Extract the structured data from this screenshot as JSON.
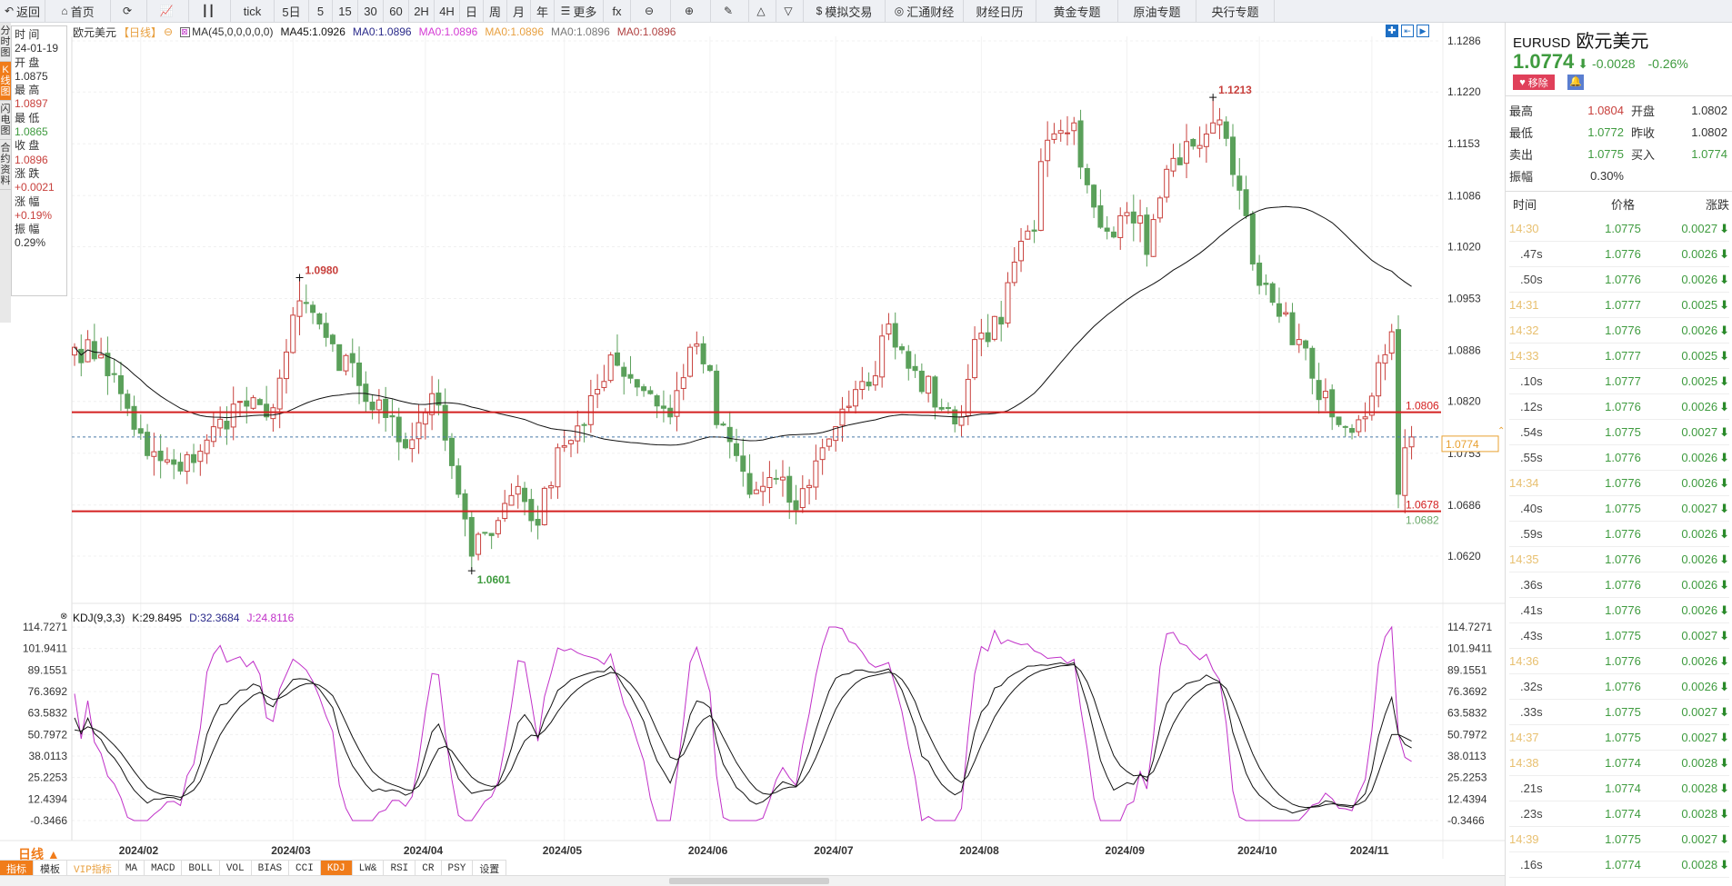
{
  "toolbar": {
    "items": [
      {
        "icon": "↶",
        "label": "返回",
        "name": "back-button"
      },
      {
        "icon": "⌂",
        "label": "首页",
        "name": "home-button"
      },
      {
        "icon": "⟳",
        "label": "",
        "name": "refresh-button"
      },
      {
        "icon": "📈",
        "label": "",
        "name": "line-chart-button"
      },
      {
        "icon": "┃┃",
        "label": "",
        "name": "candle-chart-button"
      },
      {
        "icon": "",
        "label": "tick",
        "name": "tick-button"
      },
      {
        "icon": "",
        "label": "5日",
        "name": "period-5d"
      },
      {
        "icon": "",
        "label": "5",
        "name": "period-5"
      },
      {
        "icon": "",
        "label": "15",
        "name": "period-15"
      },
      {
        "icon": "",
        "label": "30",
        "name": "period-30"
      },
      {
        "icon": "",
        "label": "60",
        "name": "period-60"
      },
      {
        "icon": "",
        "label": "2H",
        "name": "period-2h"
      },
      {
        "icon": "",
        "label": "4H",
        "name": "period-4h"
      },
      {
        "icon": "",
        "label": "日",
        "name": "period-day"
      },
      {
        "icon": "",
        "label": "周",
        "name": "period-week"
      },
      {
        "icon": "",
        "label": "月",
        "name": "period-month"
      },
      {
        "icon": "",
        "label": "年",
        "name": "period-year"
      },
      {
        "icon": "☰",
        "label": "更多",
        "name": "more-button"
      },
      {
        "icon": "",
        "label": "fx",
        "name": "formula-button"
      },
      {
        "icon": "⊖",
        "label": "",
        "name": "zoom-out-button"
      },
      {
        "icon": "⊕",
        "label": "",
        "name": "zoom-in-button"
      },
      {
        "icon": "✎",
        "label": "",
        "name": "draw-button"
      },
      {
        "icon": "△",
        "label": "",
        "name": "up-triangle-button"
      },
      {
        "icon": "▽",
        "label": "",
        "name": "down-triangle-button"
      },
      {
        "icon": "$",
        "label": "模拟交易",
        "name": "sim-trade-button"
      },
      {
        "icon": "◎",
        "label": "汇通财经",
        "name": "huitong-button"
      },
      {
        "icon": "",
        "label": "财经日历",
        "name": "calendar-button"
      },
      {
        "icon": "",
        "label": "黄金专题",
        "name": "gold-button"
      },
      {
        "icon": "",
        "label": "原油专题",
        "name": "oil-button"
      },
      {
        "icon": "",
        "label": "央行专题",
        "name": "central-bank-button"
      }
    ]
  },
  "side_tabs": [
    "分时图",
    "K线图",
    "闪电图",
    "合约资料"
  ],
  "info_panel": [
    {
      "label": "时 间",
      "value": "24-01-19",
      "color": "#333"
    },
    {
      "label": "开 盘",
      "value": "1.0875",
      "color": "#333"
    },
    {
      "label": "最 高",
      "value": "1.0897",
      "color": "#c8403c"
    },
    {
      "label": "最 低",
      "value": "1.0865",
      "color": "#3f9b3f"
    },
    {
      "label": "收 盘",
      "value": "1.0896",
      "color": "#c8403c"
    },
    {
      "label": "涨 跌",
      "value": "+0.0021",
      "color": "#c8403c"
    },
    {
      "label": "涨 幅",
      "value": "+0.19%",
      "color": "#c8403c"
    },
    {
      "label": "振 幅",
      "value": "0.29%",
      "color": "#333"
    }
  ],
  "title": {
    "name": "欧元美元",
    "period": "【日线】",
    "ma_params": "MA(45,0,0,0,0,0)",
    "ma_values": [
      {
        "text": "MA45:1.0926",
        "color": "#111"
      },
      {
        "text": "MA0:1.0896",
        "color": "#2a2a8a"
      },
      {
        "text": "MA0:1.0896",
        "color": "#d43ad4"
      },
      {
        "text": "MA0:1.0896",
        "color": "#e8a040"
      },
      {
        "text": "MA0:1.0896",
        "color": "#777"
      },
      {
        "text": "MA0:1.0896",
        "color": "#b04040"
      }
    ]
  },
  "kdj": {
    "label": "KDJ(9,3,3)",
    "k": "K:29.8495",
    "d": "D:32.3684",
    "j": "J:24.8116"
  },
  "chart_data": {
    "type": "candlestick",
    "symbol": "EURUSD",
    "period": "日线",
    "price_ticks": [
      "1.1286",
      "1.1220",
      "1.1153",
      "1.1086",
      "1.1020",
      "1.0953",
      "1.0886",
      "1.0820",
      "1.0753",
      "1.0686",
      "1.0620"
    ],
    "price_range": [
      1.062,
      1.1286
    ],
    "kdj_ticks": [
      "114.7271",
      "101.9411",
      "89.1551",
      "76.3692",
      "63.5832",
      "50.7972",
      "38.0113",
      "25.2253",
      "12.4394",
      "-0.3466"
    ],
    "kdj_range": [
      -0.3466,
      114.7271
    ],
    "date_ticks": [
      {
        "label": "2024/02",
        "idx": 10
      },
      {
        "label": "2024/03",
        "idx": 33
      },
      {
        "label": "2024/04",
        "idx": 53
      },
      {
        "label": "2024/05",
        "idx": 74
      },
      {
        "label": "2024/06",
        "idx": 96
      },
      {
        "label": "2024/07",
        "idx": 115
      },
      {
        "label": "2024/08",
        "idx": 137
      },
      {
        "label": "2024/09",
        "idx": 159
      },
      {
        "label": "2024/10",
        "idx": 179
      },
      {
        "label": "2024/11",
        "idx": 196
      }
    ],
    "candle_count": 203,
    "close_waypoints": [
      [
        0,
        1.089
      ],
      [
        4,
        1.088
      ],
      [
        7,
        1.083
      ],
      [
        11,
        1.075
      ],
      [
        16,
        1.073
      ],
      [
        20,
        1.077
      ],
      [
        25,
        1.082
      ],
      [
        29,
        1.08
      ],
      [
        31,
        1.085
      ],
      [
        34,
        1.095
      ],
      [
        37,
        1.092
      ],
      [
        40,
        1.086
      ],
      [
        42,
        1.087
      ],
      [
        44,
        1.082
      ],
      [
        48,
        1.08
      ],
      [
        50,
        1.076
      ],
      [
        54,
        1.083
      ],
      [
        56,
        1.077
      ],
      [
        58,
        1.07
      ],
      [
        60,
        1.062
      ],
      [
        62,
        1.065
      ],
      [
        67,
        1.071
      ],
      [
        70,
        1.066
      ],
      [
        73,
        1.076
      ],
      [
        77,
        1.079
      ],
      [
        81,
        1.088
      ],
      [
        84,
        1.085
      ],
      [
        87,
        1.083
      ],
      [
        90,
        1.08
      ],
      [
        93,
        1.089
      ],
      [
        96,
        1.086
      ],
      [
        97,
        1.079
      ],
      [
        100,
        1.075
      ],
      [
        102,
        1.07
      ],
      [
        106,
        1.072
      ],
      [
        109,
        1.068
      ],
      [
        113,
        1.076
      ],
      [
        116,
        1.081
      ],
      [
        120,
        1.084
      ],
      [
        123,
        1.092
      ],
      [
        127,
        1.086
      ],
      [
        131,
        1.081
      ],
      [
        134,
        1.08
      ],
      [
        136,
        1.09
      ],
      [
        140,
        1.092
      ],
      [
        142,
        1.1
      ],
      [
        145,
        1.104
      ],
      [
        146,
        1.113
      ],
      [
        149,
        1.117
      ],
      [
        151,
        1.118
      ],
      [
        153,
        1.11
      ],
      [
        156,
        1.104
      ],
      [
        158,
        1.106
      ],
      [
        161,
        1.106
      ],
      [
        162,
        1.101
      ],
      [
        165,
        1.112
      ],
      [
        169,
        1.115
      ],
      [
        172,
        1.118
      ],
      [
        174,
        1.116
      ],
      [
        177,
        1.106
      ],
      [
        179,
        1.097
      ],
      [
        182,
        1.093
      ],
      [
        185,
        1.09
      ],
      [
        187,
        1.085
      ],
      [
        190,
        1.08
      ],
      [
        191,
        1.079
      ],
      [
        193,
        1.078
      ],
      [
        195,
        1.08
      ],
      [
        197,
        1.087
      ],
      [
        199,
        1.091
      ],
      [
        200,
        1.07
      ],
      [
        201,
        1.076
      ],
      [
        202,
        1.0774
      ]
    ],
    "annotations": [
      {
        "text": "1.0980",
        "idx": 34,
        "price": 1.098,
        "color": "#c8403c"
      },
      {
        "text": "1.0601",
        "idx": 60,
        "price": 1.0601,
        "color": "#3f9b3f"
      },
      {
        "text": "1.1213",
        "idx": 172,
        "price": 1.1213,
        "color": "#c8403c"
      }
    ],
    "hlines": [
      {
        "price": 1.0806,
        "text": "1.0806",
        "color": "#d42020"
      },
      {
        "price": 1.0678,
        "text": "1.0678",
        "color": "#d42020"
      }
    ],
    "low_label": {
      "text": "1.0682",
      "color": "#6aa86a"
    },
    "current_price": {
      "price": 1.0774,
      "text": "1.0774",
      "color": "#e8a030"
    },
    "ma_period": 45,
    "up_color": "#c8403c",
    "down_color": "#5aa05a",
    "k_color": "#111",
    "d_color": "#111",
    "j_color": "#c030c8"
  },
  "bottom": {
    "period_label": "日线 ▲",
    "tabs": [
      "指标",
      "模板",
      "VIP指标",
      "MA",
      "MACD",
      "BOLL",
      "VOL",
      "BIAS",
      "CCI",
      "KDJ",
      "LW&",
      "RSI",
      "CR",
      "PSY",
      "设置"
    ]
  },
  "quote": {
    "code": "EURUSD",
    "name": "欧元美元",
    "price": "1.0774",
    "arrow": "⬇",
    "change": "-0.0028",
    "pct": "-0.26%",
    "remove_label": "移除",
    "stats": [
      {
        "l1": "最高",
        "v1": "1.0804",
        "c1": "#c8403c",
        "l2": "开盘",
        "v2": "1.0802",
        "c2": "#333"
      },
      {
        "l1": "最低",
        "v1": "1.0772",
        "c1": "#3f9b3f",
        "l2": "昨收",
        "v2": "1.0802",
        "c2": "#333"
      },
      {
        "l1": "卖出",
        "v1": "1.0775",
        "c1": "#3f9b3f",
        "l2": "买入",
        "v2": "1.0774",
        "c2": "#3f9b3f"
      },
      {
        "l1": "振幅",
        "v1": "0.30%",
        "c1": "#333",
        "l2": "",
        "v2": "",
        "c2": "#333"
      }
    ],
    "tick_headers": [
      "时间",
      "价格",
      "涨跌"
    ],
    "ticks": [
      [
        "14:30",
        "1.0775",
        "0.0027"
      ],
      [
        ".47s",
        "1.0776",
        "0.0026"
      ],
      [
        ".50s",
        "1.0776",
        "0.0026"
      ],
      [
        "14:31",
        "1.0777",
        "0.0025"
      ],
      [
        "14:32",
        "1.0776",
        "0.0026"
      ],
      [
        "14:33",
        "1.0777",
        "0.0025"
      ],
      [
        ".10s",
        "1.0777",
        "0.0025"
      ],
      [
        ".12s",
        "1.0776",
        "0.0026"
      ],
      [
        ".54s",
        "1.0775",
        "0.0027"
      ],
      [
        ".55s",
        "1.0776",
        "0.0026"
      ],
      [
        "14:34",
        "1.0776",
        "0.0026"
      ],
      [
        ".40s",
        "1.0775",
        "0.0027"
      ],
      [
        ".59s",
        "1.0776",
        "0.0026"
      ],
      [
        "14:35",
        "1.0776",
        "0.0026"
      ],
      [
        ".36s",
        "1.0776",
        "0.0026"
      ],
      [
        ".41s",
        "1.0776",
        "0.0026"
      ],
      [
        ".43s",
        "1.0775",
        "0.0027"
      ],
      [
        "14:36",
        "1.0776",
        "0.0026"
      ],
      [
        ".32s",
        "1.0776",
        "0.0026"
      ],
      [
        ".33s",
        "1.0775",
        "0.0027"
      ],
      [
        "14:37",
        "1.0775",
        "0.0027"
      ],
      [
        "14:38",
        "1.0774",
        "0.0028"
      ],
      [
        ".21s",
        "1.0774",
        "0.0028"
      ],
      [
        ".23s",
        "1.0774",
        "0.0028"
      ],
      [
        "14:39",
        "1.0775",
        "0.0027"
      ],
      [
        ".16s",
        "1.0774",
        "0.0028"
      ]
    ]
  }
}
